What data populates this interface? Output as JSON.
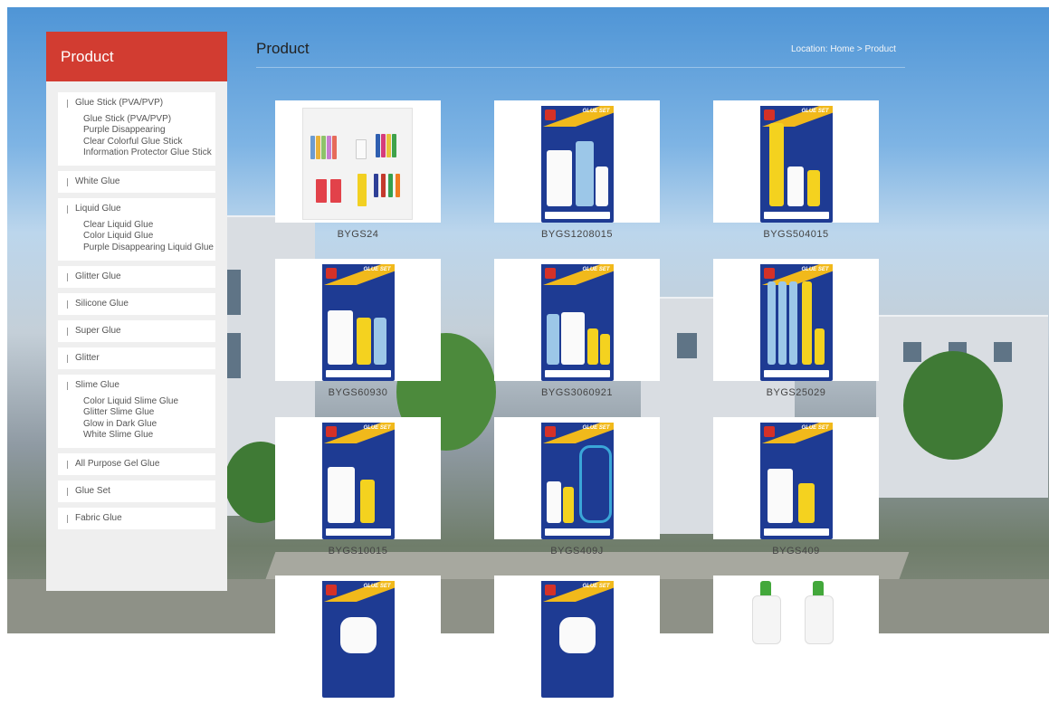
{
  "sidebar": {
    "header": "Product",
    "categories": [
      {
        "title": "Glue Stick (PVA/PVP)",
        "subs": [
          "Glue Stick (PVA/PVP)",
          "Purple Disappearing",
          "Clear Colorful Glue Stick",
          "Information Protector Glue Stick"
        ]
      },
      {
        "title": "White Glue",
        "subs": []
      },
      {
        "title": "Liquid Glue",
        "subs": [
          "Clear Liquid Glue",
          "Color Liquid Glue",
          "Purple Disappearing Liquid Glue"
        ]
      },
      {
        "title": "Glitter Glue",
        "subs": []
      },
      {
        "title": "Silicone Glue",
        "subs": []
      },
      {
        "title": "Super Glue",
        "subs": []
      },
      {
        "title": "Glitter",
        "subs": []
      },
      {
        "title": "Slime Glue",
        "subs": [
          "Color Liquid Slime Glue",
          "Glitter Slime Glue",
          "Glow in Dark Glue",
          "White Slime Glue"
        ]
      },
      {
        "title": "All Purpose Gel Glue",
        "subs": []
      },
      {
        "title": "Glue Set",
        "subs": []
      },
      {
        "title": "Fabric Glue",
        "subs": []
      }
    ]
  },
  "main": {
    "title": "Product",
    "location": {
      "prefix": "Location:",
      "home": "Home",
      "separator": ">",
      "current": "Product"
    }
  },
  "products": [
    {
      "label": "BYGS24",
      "brand": ""
    },
    {
      "label": "BYGS1208015",
      "brand": "GLUE SET"
    },
    {
      "label": "BYGS504015",
      "brand": "GLUE SET"
    },
    {
      "label": "BYGS60930",
      "brand": "GLUE SET"
    },
    {
      "label": "BYGS3060921",
      "brand": "GLUE SET"
    },
    {
      "label": "BYGS25029",
      "brand": "GLUE SET"
    },
    {
      "label": "BYGS10015",
      "brand": "GLUE SET"
    },
    {
      "label": "BYGS409J",
      "brand": "GLUE SET"
    },
    {
      "label": "BYGS409",
      "brand": "GLUE SET"
    },
    {
      "label": "",
      "brand": "GLUE SET"
    },
    {
      "label": "",
      "brand": "GLUE SET"
    },
    {
      "label": "",
      "brand": ""
    }
  ],
  "colors": {
    "accent": "#d23c31",
    "package_blue": "#1e3b93",
    "package_yellow": "#f1b91b"
  }
}
